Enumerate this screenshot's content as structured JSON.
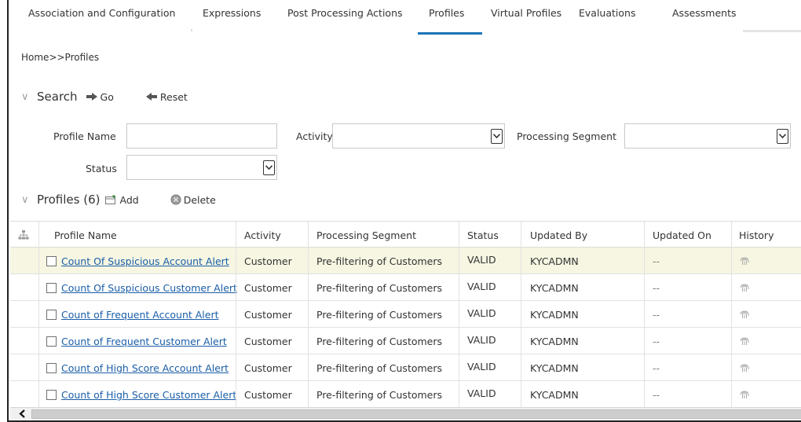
{
  "tabs": [
    {
      "label": "Association and Configuration"
    },
    {
      "label": "Expressions"
    },
    {
      "label": "Post Processing Actions"
    },
    {
      "label": "Profiles"
    },
    {
      "label": "Virtual Profiles"
    },
    {
      "label": "Evaluations"
    },
    {
      "label": "Assessments"
    }
  ],
  "active_tab": "Profiles",
  "breadcrumb": "Home>>Profiles",
  "search": {
    "title": "Search",
    "go_label": "Go",
    "reset_label": "Reset",
    "fields": {
      "profile_name_label": "Profile Name",
      "profile_name_value": "",
      "activity_label": "Activity",
      "activity_value": "",
      "segment_label": "Processing Segment",
      "segment_value": "",
      "status_label": "Status",
      "status_value": ""
    }
  },
  "profiles": {
    "title": "Profiles (6)",
    "add_label": "Add",
    "delete_label": "Delete",
    "columns": [
      "Profile Name",
      "Activity",
      "Processing Segment",
      "Status",
      "Updated By",
      "Updated On",
      "History"
    ],
    "rows": [
      {
        "name": "Count Of Suspicious Account Alert",
        "activity": "Customer",
        "segment": "Pre-filtering of Customers",
        "status": "VALID",
        "updated_by": "KYCADMN",
        "updated_on": "--"
      },
      {
        "name": "Count Of Suspicious Customer Alert",
        "activity": "Customer",
        "segment": "Pre-filtering of Customers",
        "status": "VALID",
        "updated_by": "KYCADMN",
        "updated_on": "--"
      },
      {
        "name": "Count of Frequent Account Alert",
        "activity": "Customer",
        "segment": "Pre-filtering of Customers",
        "status": "VALID",
        "updated_by": "KYCADMN",
        "updated_on": "--"
      },
      {
        "name": "Count of Frequent Customer Alert",
        "activity": "Customer",
        "segment": "Pre-filtering of Customers",
        "status": "VALID",
        "updated_by": "KYCADMN",
        "updated_on": "--"
      },
      {
        "name": "Count of High Score Account Alert",
        "activity": "Customer",
        "segment": "Pre-filtering of Customers",
        "status": "VALID",
        "updated_by": "KYCADMN",
        "updated_on": "--"
      },
      {
        "name": "Count of High Score Customer Alert",
        "activity": "Customer",
        "segment": "Pre-filtering of Customers",
        "status": "VALID",
        "updated_by": "KYCADMN",
        "updated_on": "--"
      }
    ]
  },
  "colors": {
    "accent": "#1a73b8",
    "link": "#1a5ea8",
    "row_highlight": "#f6f6e2"
  },
  "icons": {
    "go": "arrow-right-icon",
    "reset": "arrow-left-icon",
    "add": "add-icon",
    "delete": "delete-icon",
    "hierarchy": "hierarchy-icon",
    "history": "fingerprint-icon"
  }
}
